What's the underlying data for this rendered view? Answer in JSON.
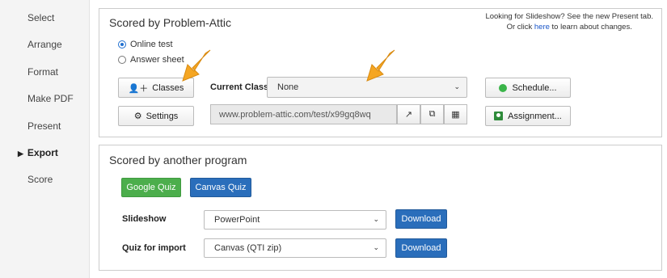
{
  "sidebar": {
    "items": [
      {
        "label": "Select"
      },
      {
        "label": "Arrange"
      },
      {
        "label": "Format"
      },
      {
        "label": "Make PDF"
      },
      {
        "label": "Present"
      },
      {
        "label": "Export",
        "active": true
      },
      {
        "label": "Score"
      }
    ]
  },
  "panel1": {
    "title": "Scored by Problem-Attic",
    "note_line1": "Looking for Slideshow? See the new Present tab.",
    "note_or": "Or click",
    "note_link": "here",
    "note_tail": "to learn about changes.",
    "radio_online": "Online test",
    "radio_answer": "Answer sheet",
    "selected_radio": "Online test",
    "classes_button": "Classes",
    "current_class_label": "Current Class:",
    "current_class_value": "None",
    "schedule_button": "Schedule...",
    "settings_button": "Settings",
    "test_url": "www.problem-attic.com/test/x99gq8wq",
    "assignment_button": "Assignment..."
  },
  "panel2": {
    "title": "Scored by another program",
    "google_quiz": "Google Quiz",
    "canvas_quiz": "Canvas Quiz",
    "slideshow_label": "Slideshow",
    "slideshow_value": "PowerPoint",
    "quiz_import_label": "Quiz for import",
    "quiz_import_value": "Canvas (QTI zip)",
    "download_label": "Download"
  },
  "colors": {
    "accent_arrow": "#f5a623",
    "green_button": "#4cae4c",
    "blue_button": "#2a6ebb",
    "link": "#1a56c8"
  },
  "icons": {
    "classes": "add-user-icon",
    "settings": "gear-icon",
    "schedule": "green-dot-icon",
    "assignment": "google-classroom-icon",
    "open_link": "external-link-icon",
    "copy": "copy-icon",
    "qr": "qr-code-icon",
    "export_marker": "triangle-right-icon"
  }
}
